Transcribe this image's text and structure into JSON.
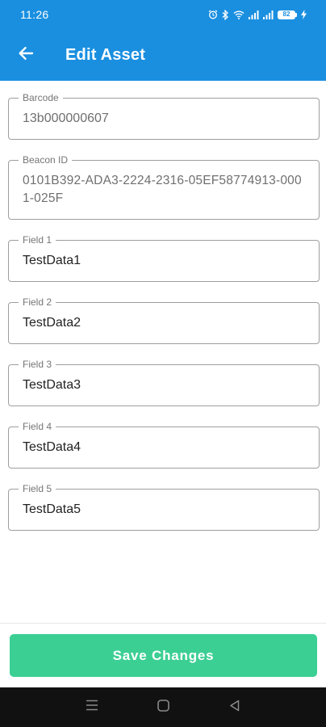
{
  "status_bar": {
    "time": "11:26",
    "battery": "82"
  },
  "app_bar": {
    "title": "Edit Asset",
    "color": "#1a8fe0"
  },
  "fields": {
    "barcode": {
      "label": "Barcode",
      "value": "13b000000607"
    },
    "beacon_id": {
      "label": "Beacon ID",
      "value": "0101B392-ADA3-2224-2316-05EF58774913-0001-025F"
    },
    "field1": {
      "label": "Field 1",
      "value": "TestData1"
    },
    "field2": {
      "label": "Field 2",
      "value": "TestData2"
    },
    "field3": {
      "label": "Field 3",
      "value": "TestData3"
    },
    "field4": {
      "label": "Field 4",
      "value": "TestData4"
    },
    "field5": {
      "label": "Field 5",
      "value": "TestData5"
    }
  },
  "save_button": {
    "label": "Save Changes",
    "color": "#3ccf94"
  },
  "icons": {
    "back": "arrow-left-icon",
    "alarm": "alarm-icon",
    "bluetooth": "bluetooth-icon",
    "wifi": "wifi-icon",
    "signal": "signal-icon",
    "battery": "battery-icon",
    "charging": "charging-bolt-icon",
    "nav_menu": "menu-lines-icon",
    "nav_home": "square-home-icon",
    "nav_back": "triangle-back-icon"
  }
}
